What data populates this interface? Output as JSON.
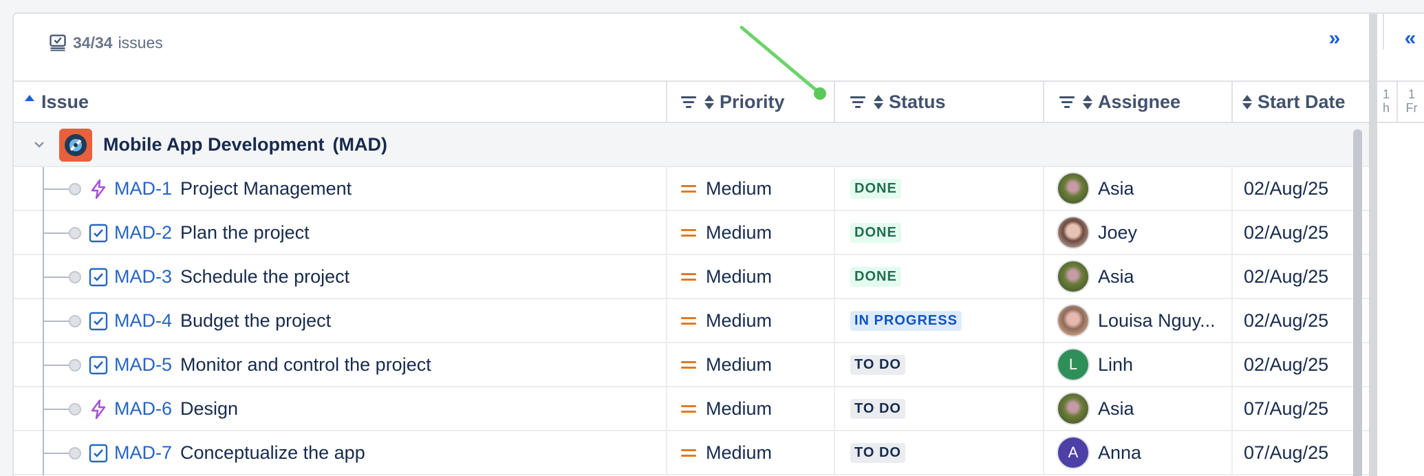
{
  "toolbar": {
    "issue_count": "34/34",
    "issues_label": "issues",
    "collapse_label": "»",
    "expand_label": "«"
  },
  "columns": {
    "issue": "Issue",
    "priority": "Priority",
    "status": "Status",
    "assignee": "Assignee",
    "start_date": "Start Date"
  },
  "timeline": [
    {
      "day": "1",
      "weekday": "h"
    },
    {
      "day": "1",
      "weekday": "Fr"
    }
  ],
  "group": {
    "name": "Mobile App Development",
    "key": "(MAD)"
  },
  "rows": [
    {
      "key": "MAD-1",
      "summary": "Project Management",
      "type": "epic",
      "priority": "Medium",
      "status": "DONE",
      "status_kind": "done",
      "assignee": "Asia",
      "avatar": "photo-green",
      "start": "02/Aug/25"
    },
    {
      "key": "MAD-2",
      "summary": "Plan the project",
      "type": "task",
      "priority": "Medium",
      "status": "DONE",
      "status_kind": "done",
      "assignee": "Joey",
      "avatar": "photo-pink",
      "start": "02/Aug/25"
    },
    {
      "key": "MAD-3",
      "summary": "Schedule the project",
      "type": "task",
      "priority": "Medium",
      "status": "DONE",
      "status_kind": "done",
      "assignee": "Asia",
      "avatar": "photo-green",
      "start": "02/Aug/25"
    },
    {
      "key": "MAD-4",
      "summary": "Budget the project",
      "type": "task",
      "priority": "Medium",
      "status": "IN PROGRESS",
      "status_kind": "progress",
      "assignee": "Louisa Nguy...",
      "avatar": "photo-warm",
      "start": "02/Aug/25"
    },
    {
      "key": "MAD-5",
      "summary": "Monitor and control the project",
      "type": "task",
      "priority": "Medium",
      "status": "TO DO",
      "status_kind": "todo",
      "assignee": "Linh",
      "avatar": "linh",
      "initial": "L",
      "start": "02/Aug/25"
    },
    {
      "key": "MAD-6",
      "summary": "Design",
      "type": "epic",
      "priority": "Medium",
      "status": "TO DO",
      "status_kind": "todo",
      "assignee": "Asia",
      "avatar": "photo-green",
      "start": "07/Aug/25"
    },
    {
      "key": "MAD-7",
      "summary": "Conceptualize the app",
      "type": "task",
      "priority": "Medium",
      "status": "TO DO",
      "status_kind": "todo",
      "assignee": "Anna",
      "avatar": "anna",
      "initial": "A",
      "start": "07/Aug/25"
    }
  ],
  "colors": {
    "link": "#2565c6",
    "priority_medium": "#e07a1f",
    "epic_icon": "#a54fd6",
    "task_icon": "#2565c6",
    "annotation_arrow": "#6dd36a"
  }
}
